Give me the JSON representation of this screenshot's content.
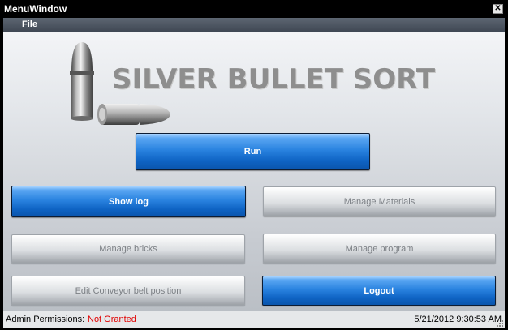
{
  "window": {
    "title": "MenuWindow",
    "close_glyph": "✕"
  },
  "menu": {
    "items": [
      {
        "label": "File"
      }
    ]
  },
  "logo": {
    "text": "SILVER BULLET SORT",
    "icon": "bullets-icon"
  },
  "buttons": {
    "run": "Run",
    "show_log": "Show log",
    "manage_materials": "Manage Materials",
    "manage_bricks": "Manage bricks",
    "manage_program": "Manage program",
    "edit_conveyor": "Edit Conveyor belt position",
    "logout": "Logout"
  },
  "status": {
    "label": "Admin Permissions:",
    "value": "Not Granted",
    "timestamp": "5/21/2012 9:30:53 AM"
  },
  "colors": {
    "primary_button": "#0f64c4",
    "disabled_text": "#7b7f84",
    "status_denied": "#e00000",
    "menubar": "#4a525e"
  }
}
